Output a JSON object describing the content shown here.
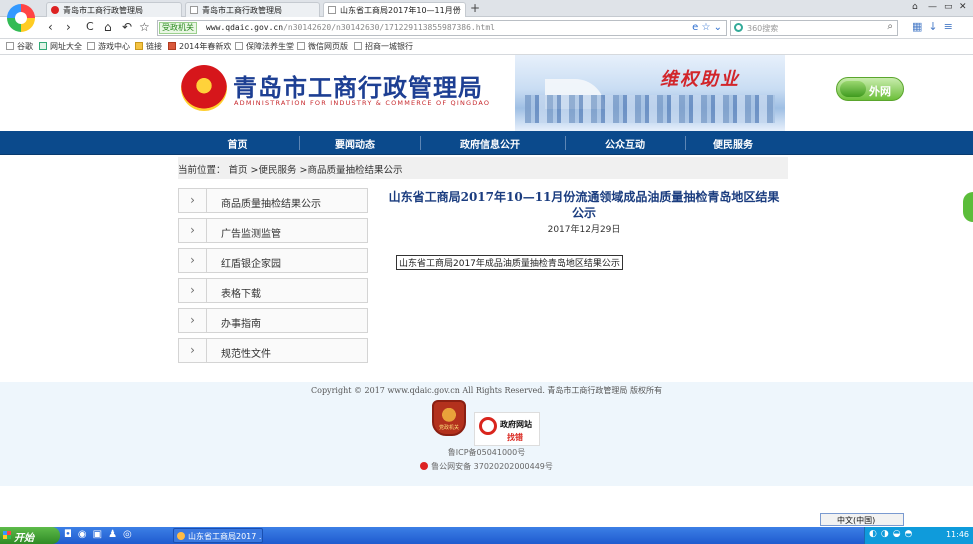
{
  "browser": {
    "tabs": [
      {
        "label": "青岛市工商行政管理局",
        "active": false
      },
      {
        "label": "青岛市工商行政管理局",
        "active": false
      },
      {
        "label": "山东省工商局2017年10—11月份",
        "active": true
      }
    ],
    "new_tab": "+",
    "nav": {
      "back": "‹",
      "forward": "›",
      "reload": "C",
      "home": "⌂",
      "undo": "↶",
      "star": "☆"
    },
    "address": {
      "verify_label": "受政机关",
      "url_main": "www.qdaic.gov.cn",
      "url_path": "/n30142620/n30142630/171229113855987386.html"
    },
    "search_placeholder": "360搜索",
    "bookmarks": [
      {
        "label": "谷歌"
      },
      {
        "label": "网址大全"
      },
      {
        "label": "游戏中心"
      },
      {
        "label": "链接"
      },
      {
        "label": "2014年春新欢"
      },
      {
        "label": "保障法养生堂"
      },
      {
        "label": "微信网页版"
      },
      {
        "label": "招商一城银行"
      }
    ]
  },
  "site": {
    "title": "青岛市工商行政管理局",
    "subtitle": "ADMINISTRATION FOR INDUSTRY & COMMERCE OF QINGDAO",
    "slogan": "维权助业",
    "extranet_label": "外网",
    "nav": [
      "首页",
      "要闻动态",
      "政府信息公开",
      "公众互动",
      "便民服务"
    ],
    "breadcrumb": {
      "prefix": "当前位置：",
      "items": [
        "首页",
        ">便民服务",
        ">商品质量抽检结果公示"
      ]
    },
    "sidebar": [
      "商品质量抽检结果公示",
      "广告监测监管",
      "红盾银企家园",
      "表格下载",
      "办事指南",
      "规范性文件"
    ],
    "article": {
      "title": "山东省工商局2017年10—11月份流通领域成品油质量抽检青岛地区结果公示",
      "date": "2017年12月29日",
      "link": "山东省工商局2017年成品油质量抽检青岛地区结果公示"
    },
    "footer": {
      "copyright": "Copyright © 2017 www.qdaic.gov.cn All Rights Reserved. 青岛市工商行政管理局 版权所有",
      "badge1": "党政机关",
      "badge2_line1": "政府网站",
      "badge2_line2": "找错",
      "icp": "鲁ICP备05041000号",
      "police": "鲁公网安备 37020202000449号"
    }
  },
  "taskbar": {
    "start": "开始",
    "task_label": "山东省工商局2017 ...",
    "ime": "中文(中国)",
    "clock": "11:46"
  }
}
